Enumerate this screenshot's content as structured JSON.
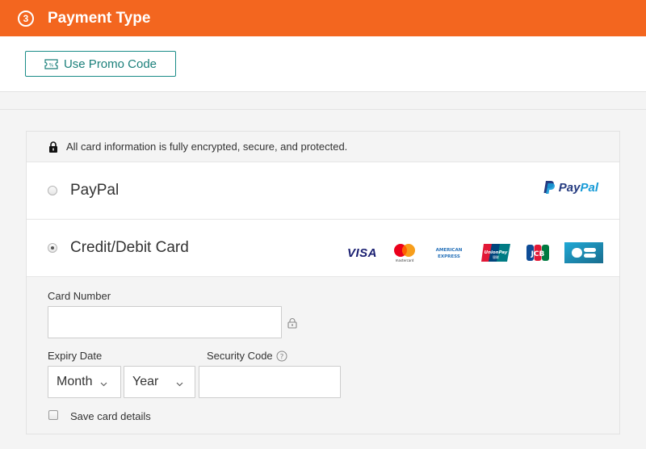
{
  "header": {
    "step": "3",
    "title": "Payment Type"
  },
  "promo": {
    "button_label": "Use Promo Code"
  },
  "security": {
    "message": "All card information is fully encrypted, secure, and protected."
  },
  "payment_options": {
    "paypal": {
      "label": "PayPal",
      "logo_text_pay": "Pay",
      "logo_text_pal": "Pal",
      "selected": false
    },
    "card": {
      "label": "Credit/Debit Card",
      "selected": true
    }
  },
  "card_brands": [
    "VISA",
    "mastercard",
    "AMERICAN EXPRESS",
    "UnionPay",
    "JCB",
    "CB"
  ],
  "card_form": {
    "card_number_label": "Card Number",
    "card_number_value": "",
    "expiry_label": "Expiry Date",
    "month_value": "Month",
    "year_value": "Year",
    "security_code_label": "Security Code",
    "security_code_value": "",
    "save_card_label": "Save card details",
    "save_card_checked": false
  },
  "colors": {
    "accent": "#f3661f",
    "promo_teal": "#1a8c87",
    "paypal_dark": "#253b80",
    "paypal_light": "#179bd7"
  }
}
